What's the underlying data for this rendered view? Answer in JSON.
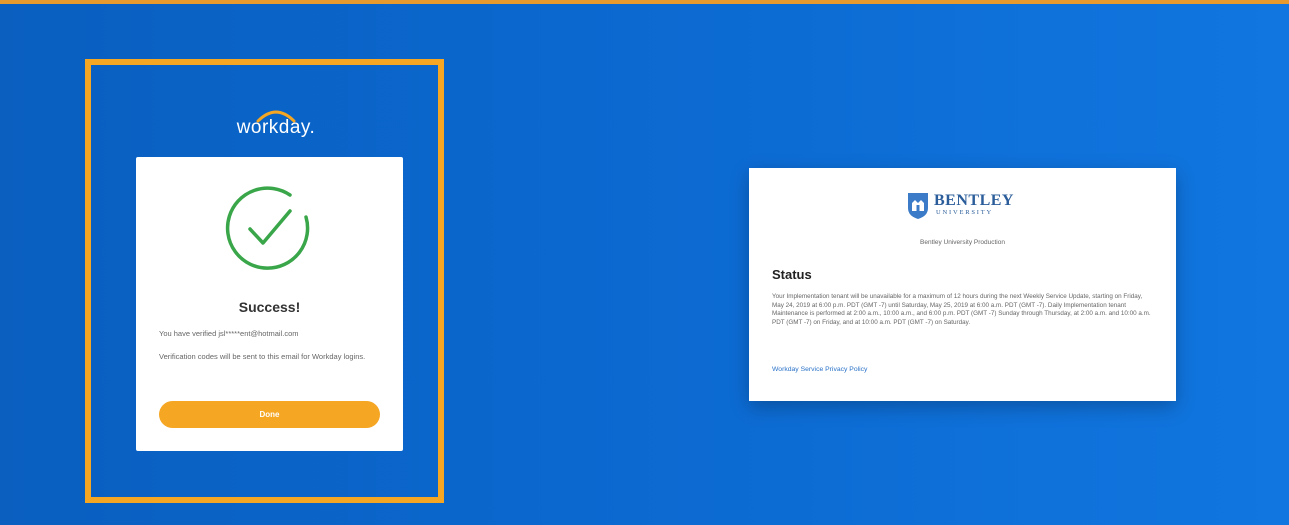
{
  "workday": {
    "logo_text": "workday.",
    "success_title": "Success!",
    "verified_text": "You have verified jsl*****ent@hotmail.com",
    "codes_text": "Verification codes will be sent to this email for Workday logins.",
    "done_label": "Done"
  },
  "status_card": {
    "org_name": "BENTLEY",
    "org_sub": "UNIVERSITY",
    "tenant_name": "Bentley University Production",
    "heading": "Status",
    "body": "Your Implementation tenant will be unavailable for a maximum of 12 hours during the next Weekly Service Update, starting on Friday, May 24, 2019 at 6:00 p.m. PDT (GMT -7) until Saturday, May 25, 2019 at 6:00 a.m. PDT (GMT -7). Daily Implementation tenant Maintenance is performed at 2:00 a.m., 10:00 a.m., and 6:00 p.m. PDT (GMT -7) Sunday through Thursday, at 2:00 a.m. and 10:00 a.m. PDT (GMT -7) on Friday, and at 10:00 a.m. PDT (GMT -7) on Saturday.",
    "privacy_link": "Workday Service Privacy Policy"
  },
  "colors": {
    "highlight": "#f5a623",
    "success_green": "#3aa64a",
    "link_blue": "#2a72c7",
    "background_blue": "#0b68cf"
  }
}
